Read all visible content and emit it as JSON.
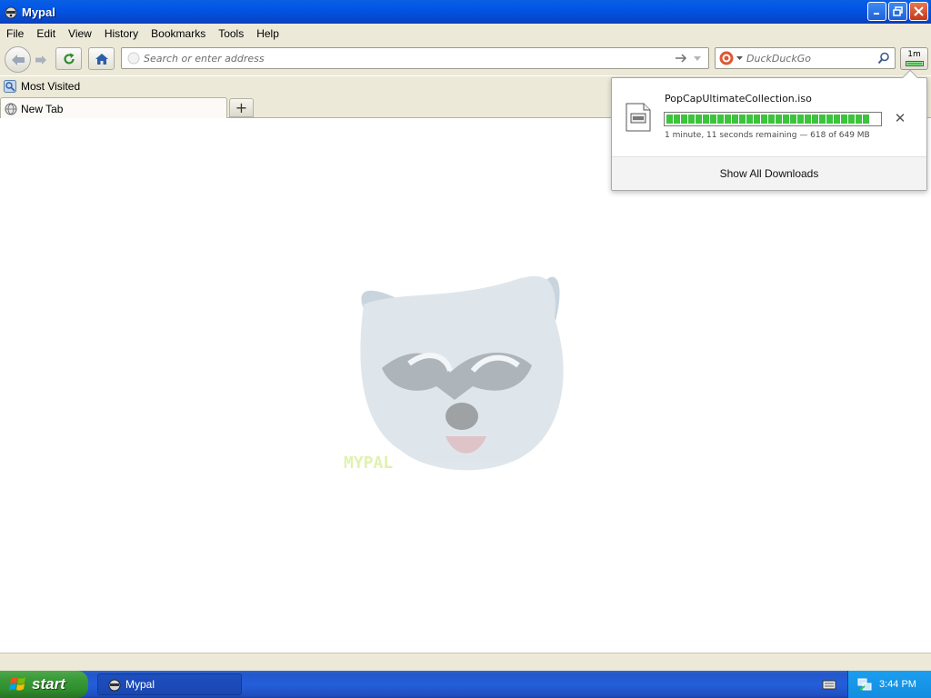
{
  "window": {
    "title": "Mypal"
  },
  "menu": [
    "File",
    "Edit",
    "View",
    "History",
    "Bookmarks",
    "Tools",
    "Help"
  ],
  "navbar": {
    "url_placeholder": "Search or enter address",
    "search_placeholder": "DuckDuckGo",
    "downloads_badge": "1m"
  },
  "bookmarks": [
    {
      "label": "Most Visited"
    }
  ],
  "tabs": [
    {
      "label": "New Tab"
    }
  ],
  "new_tab_glyph": "+",
  "downloads_panel": {
    "filename": "PopCapUltimateCollection.iso",
    "progress_fraction": 0.952,
    "status": "1 minute, 11 seconds remaining — 618 of 649 MB",
    "cancel_glyph": "✕",
    "show_all_label": "Show All Downloads"
  },
  "taskbar": {
    "start_label": "start",
    "items": [
      {
        "label": "Mypal"
      }
    ],
    "clock": "3:44 PM"
  },
  "colors": {
    "titlebar": "#0a5fe4",
    "chrome": "#ece9d8",
    "progress": "#3cc43c",
    "start": "#3b9a3a",
    "taskbar": "#245edb"
  },
  "icons": {
    "app": "raccoon-icon",
    "back": "back-arrow-icon",
    "forward": "forward-arrow-icon",
    "reload": "reload-icon",
    "home": "home-icon",
    "go": "go-arrow-icon",
    "search_engine": "duckduckgo-icon",
    "search": "magnifier-icon",
    "downloads": "downloads-icon"
  }
}
